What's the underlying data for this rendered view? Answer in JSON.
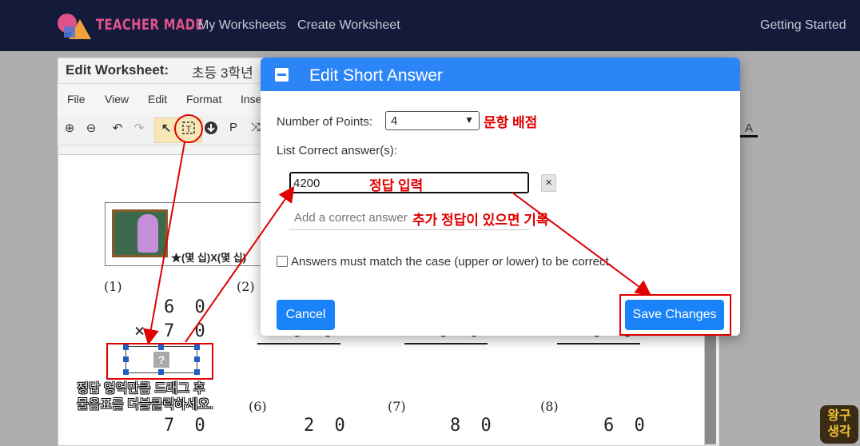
{
  "nav": {
    "brand": "TEACHER MADE",
    "links": [
      "My Worksheets",
      "Create Worksheet"
    ],
    "getting_started": "Getting Started"
  },
  "editor": {
    "title": "Edit Worksheet:",
    "worksheet_name": "초등 3학년",
    "menu": [
      "File",
      "View",
      "Edit",
      "Format",
      "Inse"
    ],
    "toolbar_letters": {
      "p": "P",
      "a": "A"
    },
    "paper": {
      "caption": "★(몇 십)X(몇 십)",
      "q1": "(1)",
      "q2": "(2)",
      "q6": "(6)",
      "q7": "(7)",
      "q8": "(8)",
      "q1_top": "6 0",
      "q1_times": "×",
      "q1_bottom": "7 0",
      "col2_partial": "0 0",
      "col3_partial": "0 0",
      "col4_partial": "0 0",
      "row2_q5": "7 0",
      "row2_q6": "2 0",
      "row2_q7": "8 0",
      "row2_q8": "6 0",
      "placeholder_mark": "?"
    }
  },
  "modal": {
    "title": "Edit Short Answer",
    "points_label": "Number of Points:",
    "points_value": "4",
    "answers_label": "List Correct answer(s):",
    "answer_value": "4200",
    "remove_symbol": "×",
    "add_placeholder": "Add a correct answer",
    "case_label": "Answers must match the case (upper or lower) to be correct.",
    "cancel_label": "Cancel",
    "save_label": "Save Changes"
  },
  "annotations": {
    "points_note": "문항 배점",
    "answer_note": "정답 입력",
    "extra_note": "추가 정답이 있으면 기록",
    "instruction": "정답 영역만큼 드래그 후\n물음표를 더블클릭하세요.",
    "badge_line1": "왕구",
    "badge_line2": "생각"
  },
  "colors": {
    "nav": "#131a3a",
    "primary": "#1a83f9",
    "annotation": "#e00000"
  }
}
